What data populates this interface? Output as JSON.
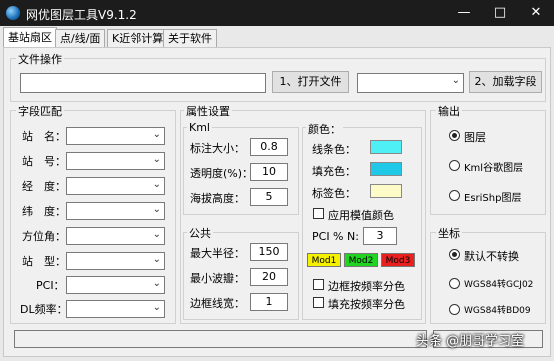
{
  "window": {
    "title": "网优图层工具V9.1.2"
  },
  "tabs": [
    {
      "label": "基站扇区"
    },
    {
      "label": "点/线/面"
    },
    {
      "label": "K近邻计算"
    },
    {
      "label": "关于软件"
    }
  ],
  "file_ops": {
    "title": "文件操作",
    "open_button": "1、打开文件",
    "load_button": "2、加载字段"
  },
  "field_match": {
    "title": "字段匹配",
    "fields": [
      {
        "label": "站　名："
      },
      {
        "label": "站　号："
      },
      {
        "label": "经　度："
      },
      {
        "label": "纬　度："
      },
      {
        "label": "方位角："
      },
      {
        "label": "站　型："
      },
      {
        "label": "PCI："
      },
      {
        "label": "DL频率："
      }
    ]
  },
  "attributes": {
    "title": "属性设置",
    "kml": {
      "title": "Kml",
      "rows": [
        {
          "label": "标注大小：",
          "value": "0.8"
        },
        {
          "label": "透明度(%)：",
          "value": "10"
        },
        {
          "label": "海拔高度：",
          "value": "5"
        }
      ]
    },
    "common": {
      "title": "公共",
      "rows": [
        {
          "label": "最大半径：",
          "value": "150"
        },
        {
          "label": "最小波瓣：",
          "value": "20"
        },
        {
          "label": "边框线宽：",
          "value": "1"
        }
      ]
    },
    "color": {
      "title": "颜色：",
      "rows": [
        {
          "label": "线条色：",
          "color": "#4ef0f5"
        },
        {
          "label": "填充色：",
          "color": "#1ec8e6"
        },
        {
          "label": "标签色：",
          "color": "#fdfcc8"
        }
      ],
      "apply_mod": "应用模值颜色",
      "pci_label": "PCI % N:",
      "pci_value": "3",
      "mods": [
        {
          "label": "Mod1",
          "color": "#f5f000"
        },
        {
          "label": "Mod2",
          "color": "#22d422"
        },
        {
          "label": "Mod3",
          "color": "#e82020"
        }
      ],
      "border_by_freq": "边框按频率分色",
      "fill_by_freq": "填充按频率分色"
    }
  },
  "output": {
    "title": "输出",
    "options": [
      {
        "label": "图层",
        "selected": true
      },
      {
        "label": "Kml谷歌图层",
        "selected": false
      },
      {
        "label": "EsriShp图层",
        "selected": false
      }
    ]
  },
  "coords": {
    "title": "坐标",
    "options": [
      {
        "label": "默认不转换",
        "selected": true
      },
      {
        "label": "WGS84转GCJ02",
        "selected": false
      },
      {
        "label": "WGS84转BD09",
        "selected": false
      }
    ]
  },
  "watermark": "头条 @朋哥学习室"
}
